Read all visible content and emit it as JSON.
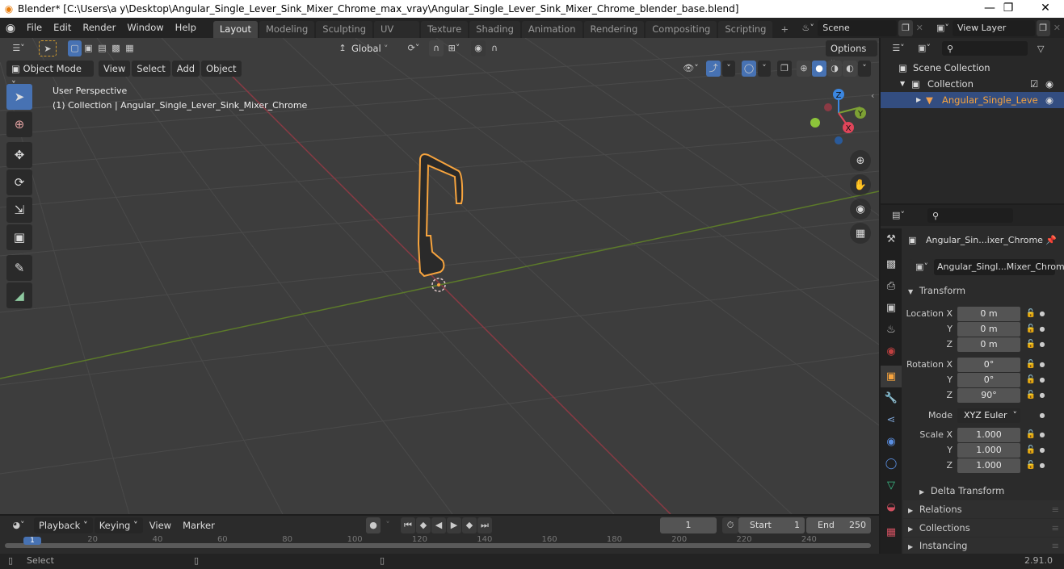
{
  "window": {
    "title": "Blender* [C:\\Users\\a y\\Desktop\\Angular_Single_Lever_Sink_Mixer_Chrome_max_vray\\Angular_Single_Lever_Sink_Mixer_Chrome_blender_base.blend]",
    "controls": [
      "minimize",
      "maximize",
      "close"
    ]
  },
  "menu": [
    "File",
    "Edit",
    "Render",
    "Window",
    "Help"
  ],
  "workspaces": {
    "active": "Layout",
    "tabs": [
      "Layout",
      "Modeling",
      "Sculpting",
      "UV Editing",
      "Texture Paint",
      "Shading",
      "Animation",
      "Rendering",
      "Compositing",
      "Scripting"
    ],
    "add": "+"
  },
  "scene": {
    "name": "Scene"
  },
  "view_layer": {
    "name": "View Layer"
  },
  "viewport": {
    "mode": "Object Mode",
    "menus": [
      "View",
      "Select",
      "Add",
      "Object"
    ],
    "orientation": "Global",
    "options_label": "Options",
    "overlay_title": "User Perspective",
    "overlay_subtitle": "(1) Collection | Angular_Single_Lever_Sink_Mixer_Chrome",
    "gizmo_axes": {
      "x": "X",
      "y": "Y",
      "z": "Z"
    },
    "colors": {
      "x_axis": "#e0455a",
      "y_axis": "#7da134",
      "z_axis": "#3b86e0",
      "selection": "#f7a43e",
      "active_tool": "#4772b3"
    }
  },
  "tools": [
    "select-box",
    "cursor",
    "move",
    "rotate",
    "scale",
    "transform",
    "annotate",
    "measure"
  ],
  "outliner": {
    "search_placeholder": "",
    "rows": [
      {
        "label": "Scene Collection",
        "level": 0
      },
      {
        "label": "Collection",
        "level": 1,
        "checked": true,
        "visible": true
      },
      {
        "label": "Angular_Single_Leve",
        "level": 2,
        "selected": true,
        "visible": true
      }
    ]
  },
  "properties": {
    "search_placeholder": "",
    "object_name": "Angular_Sin...ixer_Chrome",
    "data_name": "Angular_Singl...Mixer_Chrome",
    "transform": {
      "title": "Transform",
      "location": {
        "label": "Location X",
        "x": "0 m",
        "y": "0 m",
        "z": "0 m"
      },
      "rotation": {
        "label": "Rotation X",
        "x": "0°",
        "y": "0°",
        "z": "90°"
      },
      "mode_label": "Mode",
      "mode_value": "XYZ Euler",
      "scale": {
        "label": "Scale X",
        "x": "1.000",
        "y": "1.000",
        "z": "1.000"
      },
      "axis_y": "Y",
      "axis_z": "Z"
    },
    "delta_transform": "Delta Transform",
    "sections": [
      "Relations",
      "Collections",
      "Instancing"
    ]
  },
  "timeline": {
    "menus": [
      "Playback",
      "Keying",
      "View",
      "Marker"
    ],
    "current_frame": "1",
    "start_label": "Start",
    "start": "1",
    "end_label": "End",
    "end": "250",
    "ruler": [
      "1",
      "20",
      "40",
      "60",
      "80",
      "100",
      "120",
      "140",
      "160",
      "180",
      "200",
      "220",
      "240"
    ]
  },
  "status": {
    "left_action": "Select",
    "version": "2.91.0"
  }
}
